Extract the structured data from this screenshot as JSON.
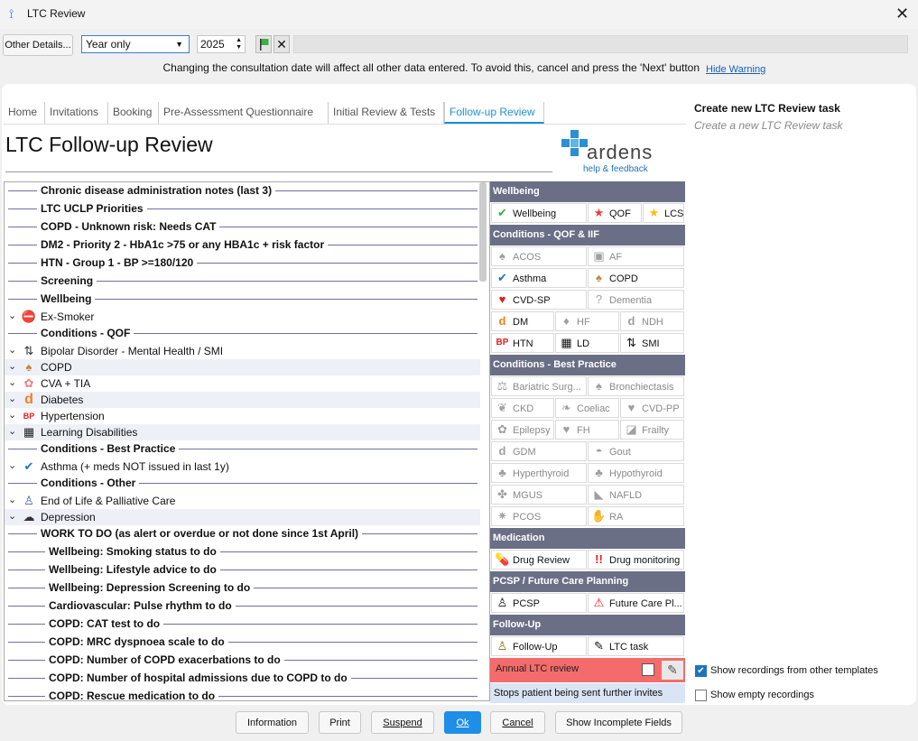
{
  "window": {
    "title": "LTC Review"
  },
  "toolbar": {
    "other_details": "Other Details...",
    "period_select": "Year only",
    "year": "2025",
    "warning": "Changing the consultation date will affect all other data entered. To avoid this, cancel and press the 'Next' button",
    "hide_warning": "Hide Warning"
  },
  "tabs": [
    "Home",
    "Invitations",
    "Booking",
    "Pre-Assessment Questionnaire",
    "Initial Review & Tests",
    "Follow-up Review"
  ],
  "page_title": "LTC Follow-up Review",
  "brand": {
    "name": "ardens",
    "help": "help & feedback"
  },
  "list": [
    {
      "kind": "header",
      "text": "Chronic disease administration notes (last 3)"
    },
    {
      "kind": "header",
      "text": "LTC UCLP Priorities"
    },
    {
      "kind": "header",
      "text": "COPD - Unknown risk: Needs CAT"
    },
    {
      "kind": "header",
      "text": "DM2 - Priority 2 - HbA1c >75 or any HBA1c + risk factor"
    },
    {
      "kind": "header",
      "text": "HTN - Group 1 - BP >=180/120"
    },
    {
      "kind": "header",
      "text": "Screening"
    },
    {
      "kind": "header",
      "text": "Wellbeing"
    },
    {
      "kind": "item",
      "text": "Ex-Smoker",
      "icon": "no-smoking-icon"
    },
    {
      "kind": "header",
      "text": "Conditions - QOF"
    },
    {
      "kind": "item",
      "text": "Bipolar Disorder - Mental Health / SMI",
      "icon": "updown-arrows-icon"
    },
    {
      "kind": "item",
      "text": "COPD",
      "icon": "lungs-icon"
    },
    {
      "kind": "item",
      "text": "CVA + TIA",
      "icon": "brain-icon"
    },
    {
      "kind": "item",
      "text": "Diabetes",
      "icon": "diabetes-icon"
    },
    {
      "kind": "item",
      "text": "Hypertension",
      "icon": "bp-icon"
    },
    {
      "kind": "item",
      "text": "Learning Disabilities",
      "icon": "ld-icon"
    },
    {
      "kind": "header",
      "text": "Conditions - Best Practice"
    },
    {
      "kind": "item",
      "text": "Asthma (+ meds NOT issued in last 1y)",
      "icon": "check-icon"
    },
    {
      "kind": "header",
      "text": "Conditions - Other"
    },
    {
      "kind": "item",
      "text": "End of Life & Palliative Care",
      "icon": "palliative-icon"
    },
    {
      "kind": "item",
      "text": "Depression",
      "icon": "depression-icon"
    },
    {
      "kind": "header",
      "text": "WORK TO DO (as alert or overdue or not done since 1st April)"
    },
    {
      "kind": "header",
      "text": "Wellbeing: Smoking status to do",
      "indent": true
    },
    {
      "kind": "header",
      "text": "Wellbeing: Lifestyle advice to do",
      "indent": true
    },
    {
      "kind": "header",
      "text": "Wellbeing: Depression Screening to do",
      "indent": true
    },
    {
      "kind": "header",
      "text": "Cardiovascular: Pulse rhythm to do",
      "indent": true
    },
    {
      "kind": "header",
      "text": "COPD: CAT test to do",
      "indent": true
    },
    {
      "kind": "header",
      "text": "COPD: MRC dyspnoea scale to do",
      "indent": true
    },
    {
      "kind": "header",
      "text": "COPD: Number of COPD exacerbations to do",
      "indent": true
    },
    {
      "kind": "header",
      "text": "COPD: Number of hospital admissions due to COPD to do",
      "indent": true
    },
    {
      "kind": "header",
      "text": "COPD: Rescue medication to do",
      "indent": true
    }
  ],
  "grid": {
    "wellbeing": {
      "title": "Wellbeing",
      "cells": [
        "Wellbeing",
        "QOF",
        "LCS"
      ]
    },
    "conditions_qof": {
      "title": "Conditions - QOF & IIF",
      "cells": [
        "ACOS",
        "AF",
        "Asthma",
        "COPD",
        "CVD-SP",
        "Dementia",
        "DM",
        "HF",
        "NDH",
        "HTN",
        "LD",
        "SMI"
      ]
    },
    "conditions_bp": {
      "title": "Conditions - Best Practice",
      "cells": [
        "Bariatric Surg...",
        "Bronchiectasis",
        "CKD",
        "Coeliac",
        "CVD-PP",
        "Epilepsy",
        "FH",
        "Frailty",
        "GDM",
        "Gout",
        "Hyperthyroid",
        "Hypothyroid",
        "MGUS",
        "NAFLD",
        "PCOS",
        "RA"
      ]
    },
    "medication": {
      "title": "Medication",
      "cells": [
        "Drug Review",
        "Drug monitoring"
      ]
    },
    "pcsp": {
      "title": "PCSP / Future Care Planning",
      "cells": [
        "PCSP",
        "Future Care Pl..."
      ]
    },
    "followup": {
      "title": "Follow-Up",
      "cells": [
        "Follow-Up",
        "LTC task"
      ]
    },
    "annual": "Annual LTC review",
    "stops": "Stops patient being sent further invites"
  },
  "task": {
    "title": "Create new LTC Review task",
    "subtitle": "Create a new LTC Review task"
  },
  "options": {
    "show_other": "Show recordings from other templates",
    "show_empty": "Show empty recordings"
  },
  "buttons": [
    "Information",
    "Print",
    "Suspend",
    "Ok",
    "Cancel",
    "Show Incomplete Fields"
  ]
}
